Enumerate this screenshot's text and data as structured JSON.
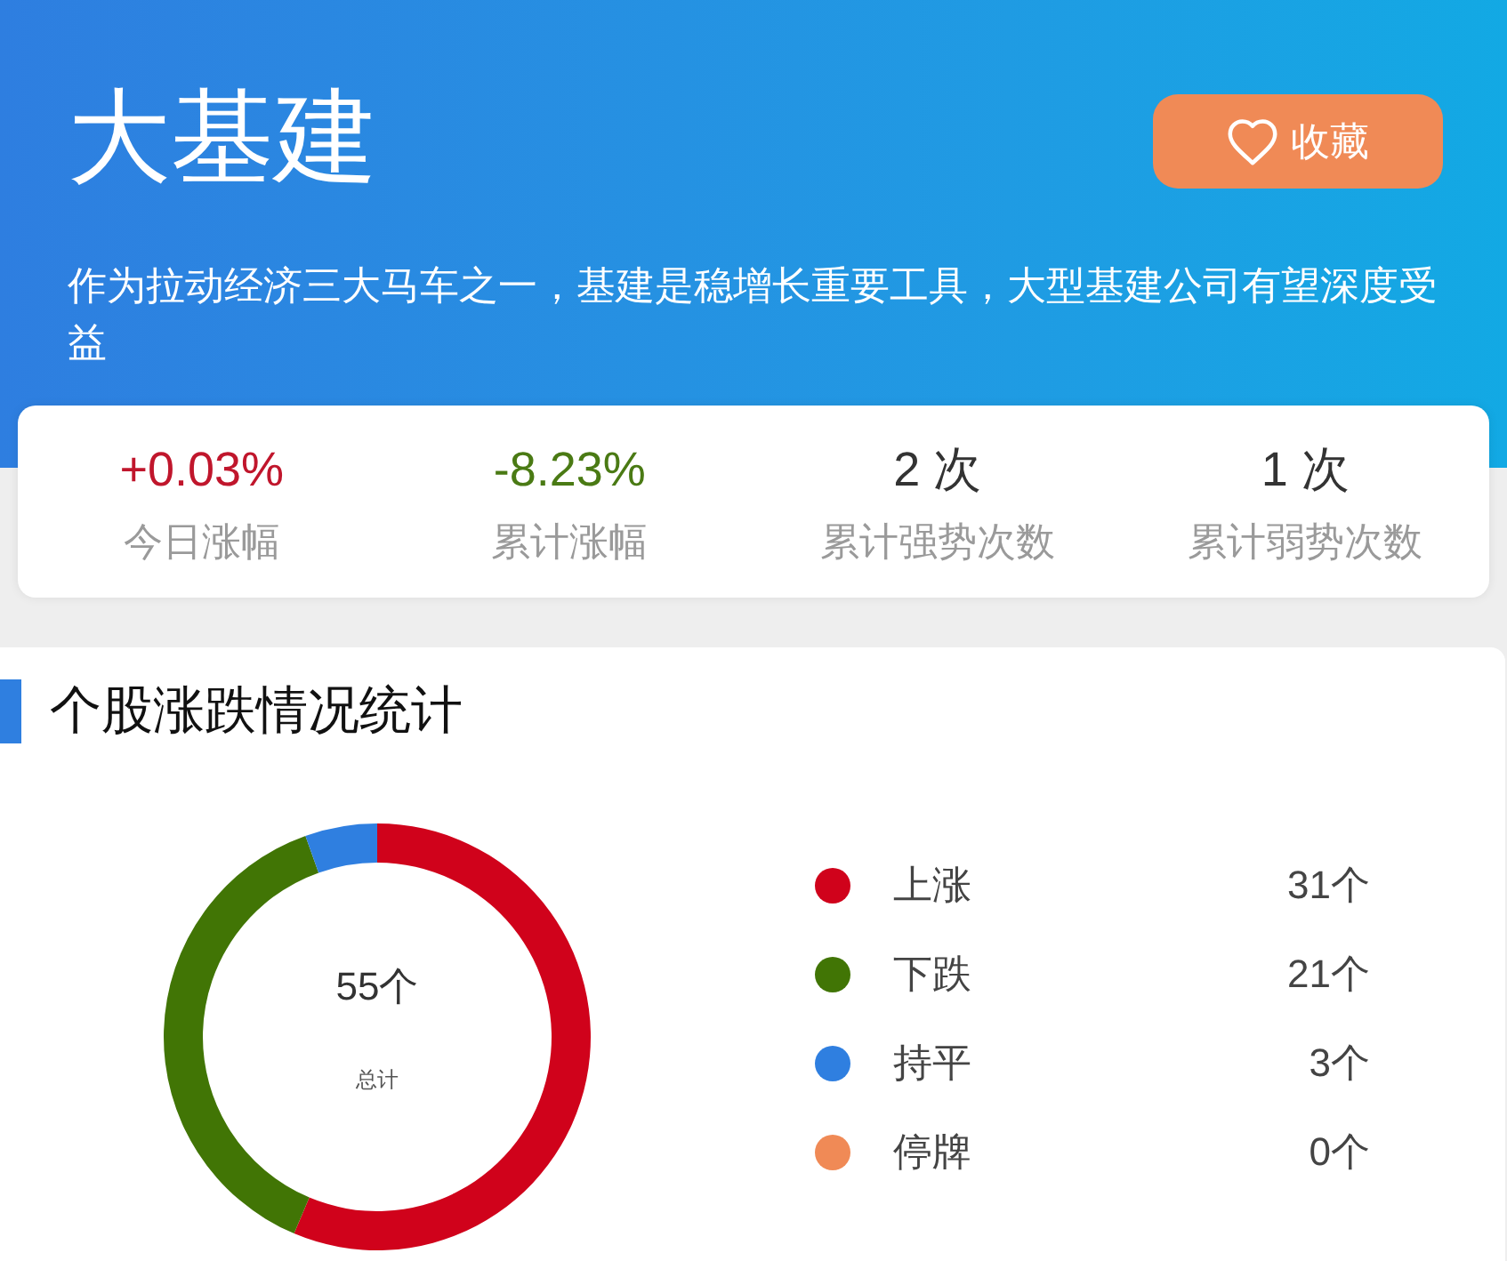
{
  "header": {
    "title": "大基建",
    "favorite_button": {
      "label": "收藏"
    },
    "description": "作为拉动经济三大马车之一，基建是稳增长重要工具，大型基建公司有望深度受益"
  },
  "stats": [
    {
      "value": "+0.03%",
      "label": "今日涨幅",
      "color": "#c0162c"
    },
    {
      "value": "-8.23%",
      "label": "累计涨幅",
      "color": "#4a7a14"
    },
    {
      "value": "2 次",
      "label": "累计强势次数",
      "color": "#333333"
    },
    {
      "value": "1 次",
      "label": "累计弱势次数",
      "color": "#333333"
    }
  ],
  "distribution": {
    "title": "个股涨跌情况统计",
    "total": "55个",
    "total_label": "总计",
    "chart_data": {
      "type": "donut",
      "categories": [
        "上涨",
        "下跌",
        "持平",
        "停牌"
      ],
      "values": [
        31,
        21,
        3,
        0
      ],
      "value_labels": [
        "31个",
        "21个",
        "3个",
        "0个"
      ],
      "legend": "right"
    },
    "legend": [
      {
        "color": "#d0021b"
      },
      {
        "color": "#417505"
      },
      {
        "color": "#2f7fe0"
      },
      {
        "color": "#f08a56"
      }
    ]
  }
}
